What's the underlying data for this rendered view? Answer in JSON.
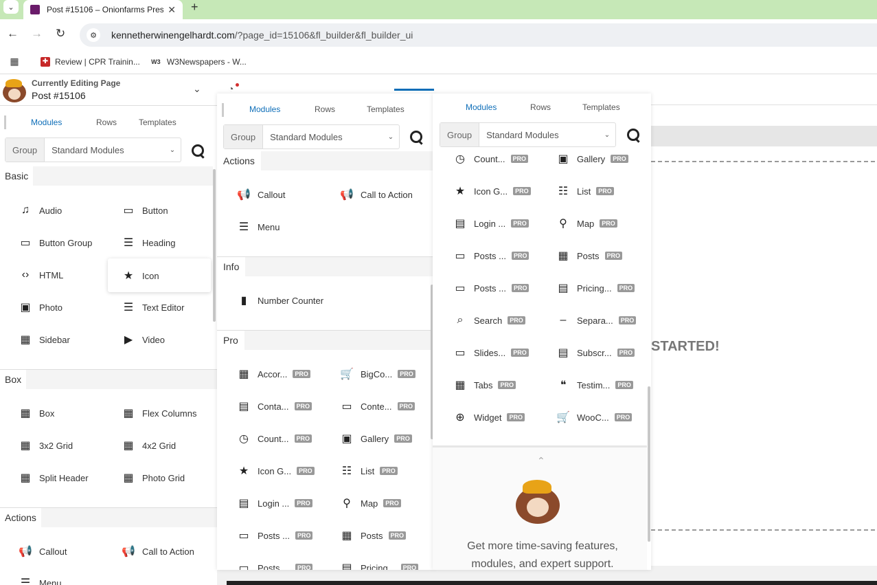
{
  "browser": {
    "tab_title": "Post #15106 – Onionfarms Pres",
    "url_host": "kennetherwinengelhardt.com",
    "url_path": "/?page_id=15106&fl_builder&fl_builder_ui",
    "bookmarks": [
      {
        "label": "Review | CPR Trainin..."
      },
      {
        "label": "W3Newspapers - W..."
      }
    ]
  },
  "editor": {
    "currently_editing": "Currently Editing Page",
    "post_title": "Post #15106"
  },
  "panel_tabs": [
    "Modules",
    "Rows",
    "Templates"
  ],
  "group": {
    "label": "Group",
    "value": "Standard Modules"
  },
  "pro_badge": "PRO",
  "left_panel": {
    "sections": [
      {
        "title": "Basic",
        "items": [
          "Audio",
          "Button",
          "Button Group",
          "Heading",
          "HTML",
          "Icon",
          "Photo",
          "Text Editor",
          "Sidebar",
          "Video"
        ]
      },
      {
        "title": "Box",
        "items": [
          "Box",
          "Flex Columns",
          "3x2 Grid",
          "4x2 Grid",
          "Split Header",
          "Photo Grid"
        ]
      },
      {
        "title": "Actions",
        "items": [
          "Callout",
          "Call to Action",
          "Menu"
        ]
      }
    ]
  },
  "middle_panel": {
    "actions_title": "Actions",
    "actions": [
      "Callout",
      "Call to Action",
      "Menu"
    ],
    "info_title": "Info",
    "info": [
      "Number Counter"
    ],
    "pro_title": "Pro",
    "pro": [
      "Accor...",
      "BigCo...",
      "Conta...",
      "Conte...",
      "Count...",
      "Gallery",
      "Icon G...",
      "List",
      "Login ...",
      "Map",
      "Posts ...",
      "Posts",
      "Posts ...",
      "Pricing..."
    ]
  },
  "right_panel": {
    "pro": [
      "Count...",
      "Gallery",
      "Icon G...",
      "List",
      "Login ...",
      "Map",
      "Posts ...",
      "Posts",
      "Posts ...",
      "Pricing...",
      "Search",
      "Separa...",
      "Slides...",
      "Subscr...",
      "Tabs",
      "Testim...",
      "Widget",
      "WooC..."
    ],
    "promo": "Get more time-saving features, modules, and expert support."
  },
  "page": {
    "started_text": "STARTED!"
  }
}
